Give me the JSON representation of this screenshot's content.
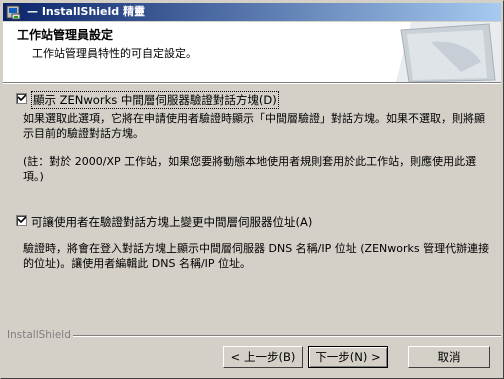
{
  "window": {
    "title": "— InstallShield 精靈"
  },
  "header": {
    "title": "工作站管理員設定",
    "subtitle": "工作站管理員特性的可自定設定。"
  },
  "option1": {
    "label": "顯示 ZENworks 中間層伺服器驗證對話方塊(D)",
    "checked": true,
    "description": "如果選取此選項，它將在申請使用者驗證時顯示「中間層驗證」對話方塊。如果不選取，則將顯示目前的驗證對話方塊。",
    "note": "(註：對於 2000/XP 工作站，如果您要將動態本地使用者規則套用於此工作站，則應使用此選項。)"
  },
  "option2": {
    "label": "可讓使用者在驗證對話方塊上變更中間層伺服器位址(A)",
    "checked": true,
    "description": "驗證時，將會在登入對話方塊上顯示中間層伺服器 DNS 名稱/IP 位址 (ZENworks 管理代辦連接的位址)。讓使用者編輯此 DNS 名稱/IP 位址。"
  },
  "footer": {
    "brand": "InstallShield",
    "back_label": "< 上一步(B)",
    "next_label": "下一步(N) >",
    "cancel_label": "取消"
  }
}
